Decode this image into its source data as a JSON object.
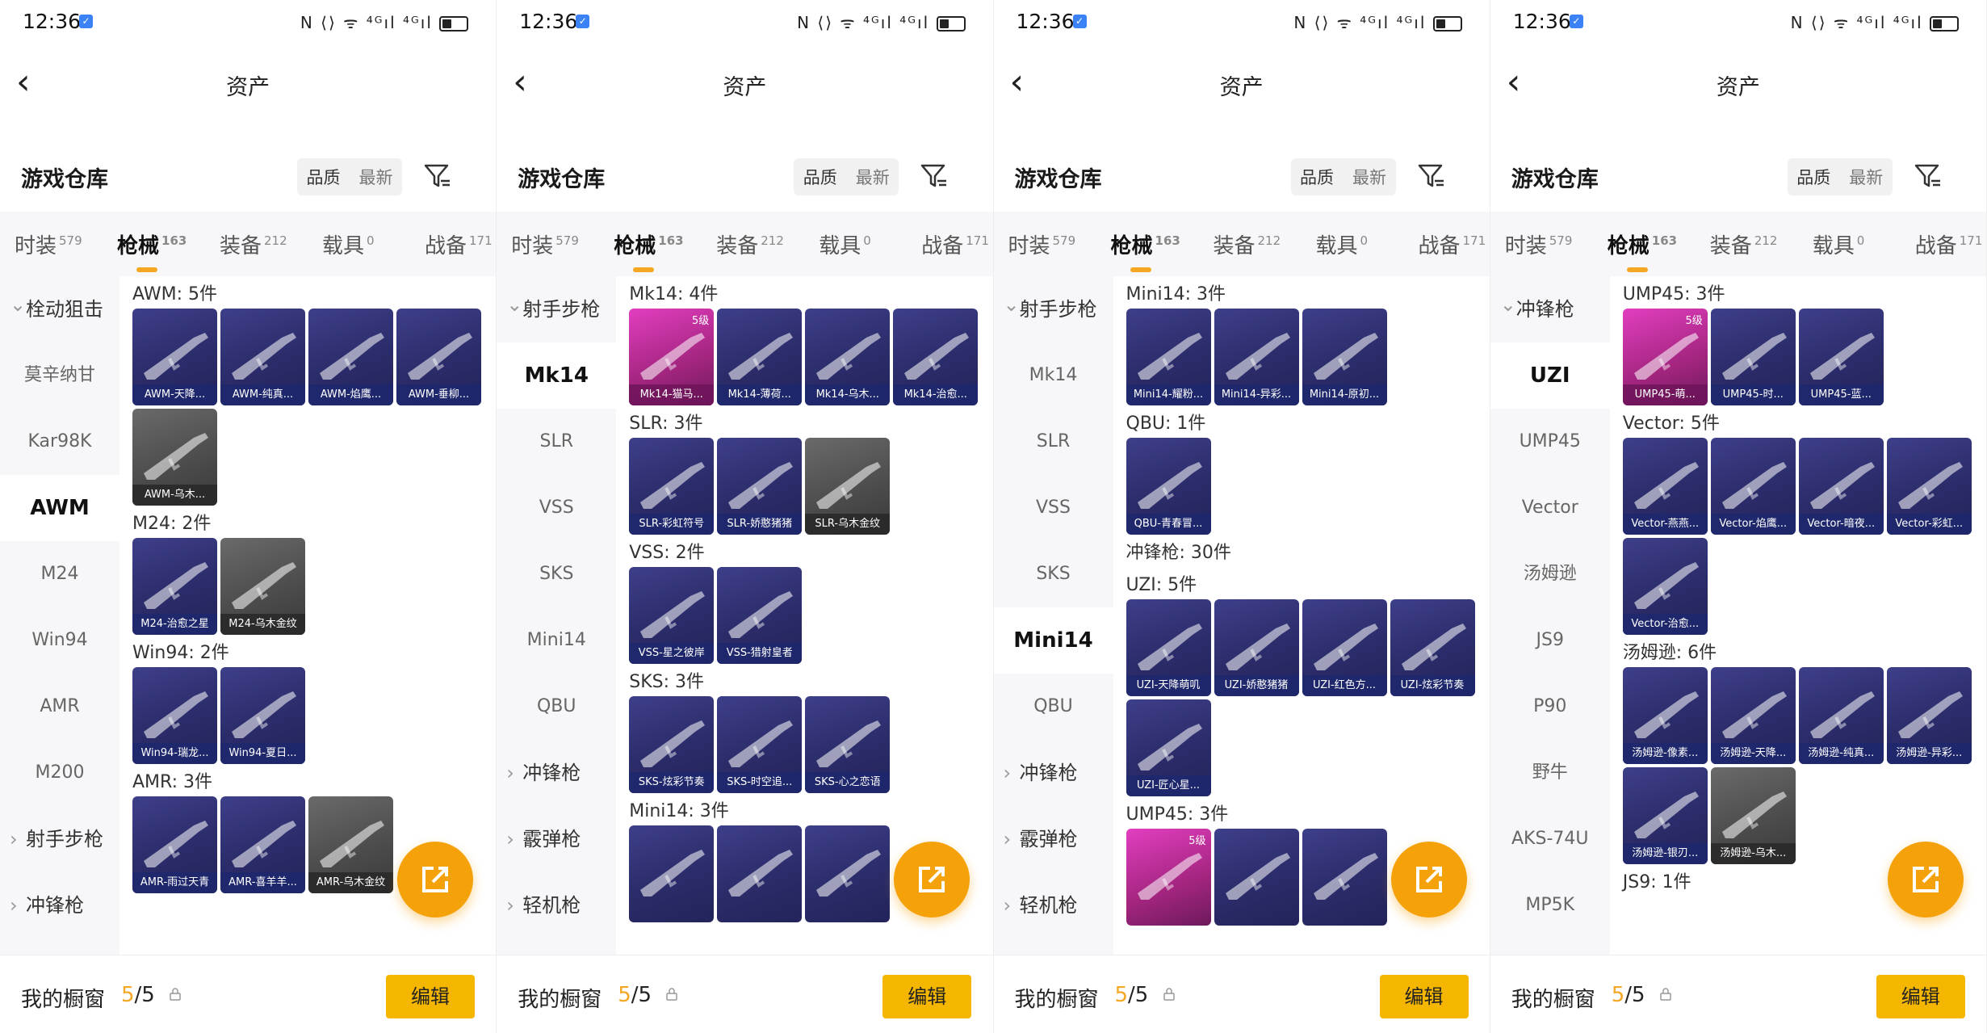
{
  "status": {
    "time": "12:36",
    "icons": "N ⟨⟩ ᯤ ⁴ᴳıl ⁴ᴳıl"
  },
  "header": {
    "back": "<",
    "title": "资产"
  },
  "warehouse": {
    "title": "游戏仓库",
    "sort_quality": "品质",
    "sort_latest": "最新"
  },
  "tabs": [
    {
      "label": "时装",
      "count": "579"
    },
    {
      "label": "枪械",
      "count": "163"
    },
    {
      "label": "装备",
      "count": "212"
    },
    {
      "label": "载具",
      "count": "0"
    },
    {
      "label": "战备",
      "count": "171"
    }
  ],
  "footer": {
    "label": "我的橱窗",
    "current": "5",
    "total": "/5",
    "edit": "编辑"
  },
  "colors": {
    "accent": "#f5a623",
    "fab": "#f5a10a",
    "edit_button": "#f5b600"
  },
  "panels": [
    {
      "sidebar": [
        {
          "label": "栓动狙击",
          "type": "cat",
          "open": true
        },
        {
          "label": "莫辛纳甘"
        },
        {
          "label": "Kar98K"
        },
        {
          "label": "AWM",
          "active": true
        },
        {
          "label": "M24"
        },
        {
          "label": "Win94"
        },
        {
          "label": "AMR"
        },
        {
          "label": "M200"
        },
        {
          "label": "射手步枪",
          "type": "cat"
        },
        {
          "label": "冲锋枪",
          "type": "cat"
        }
      ],
      "groups": [
        {
          "title": "AWM: 5件",
          "items": [
            {
              "name": "AWM-天降..."
            },
            {
              "name": "AWM-纯真..."
            },
            {
              "name": "AWM-焰鹰..."
            },
            {
              "name": "AWM-垂柳..."
            },
            {
              "name": "AWM-乌木...",
              "style": "gray"
            }
          ]
        },
        {
          "title": "M24: 2件",
          "items": [
            {
              "name": "M24-治愈之星"
            },
            {
              "name": "M24-乌木金纹",
              "style": "gray"
            }
          ]
        },
        {
          "title": "Win94: 2件",
          "items": [
            {
              "name": "Win94-瑞龙..."
            },
            {
              "name": "Win94-夏日..."
            }
          ]
        },
        {
          "title": "AMR: 3件",
          "items": [
            {
              "name": "AMR-雨过天青"
            },
            {
              "name": "AMR-喜羊羊..."
            },
            {
              "name": "AMR-乌木金纹",
              "style": "gray"
            }
          ]
        }
      ]
    },
    {
      "sidebar": [
        {
          "label": "射手步枪",
          "type": "cat",
          "open": true
        },
        {
          "label": "Mk14",
          "active": true
        },
        {
          "label": "SLR"
        },
        {
          "label": "VSS"
        },
        {
          "label": "SKS"
        },
        {
          "label": "Mini14"
        },
        {
          "label": "QBU"
        },
        {
          "label": "冲锋枪",
          "type": "cat"
        },
        {
          "label": "霰弹枪",
          "type": "cat"
        },
        {
          "label": "轻机枪",
          "type": "cat"
        }
      ],
      "groups": [
        {
          "title": "Mk14: 4件",
          "items": [
            {
              "name": "Mk14-猫马...",
              "style": "pink",
              "level": "5级"
            },
            {
              "name": "Mk14-薄荷..."
            },
            {
              "name": "Mk14-乌木..."
            },
            {
              "name": "Mk14-治愈..."
            }
          ]
        },
        {
          "title": "SLR: 3件",
          "items": [
            {
              "name": "SLR-彩虹符号"
            },
            {
              "name": "SLR-娇憨猪猪"
            },
            {
              "name": "SLR-乌木金纹",
              "style": "gray"
            }
          ]
        },
        {
          "title": "VSS: 2件",
          "items": [
            {
              "name": "VSS-星之彼岸"
            },
            {
              "name": "VSS-猎射皇者"
            }
          ]
        },
        {
          "title": "SKS: 3件",
          "items": [
            {
              "name": "SKS-炫彩节奏"
            },
            {
              "name": "SKS-时空追..."
            },
            {
              "name": "SKS-心之恋语"
            }
          ]
        },
        {
          "title": "Mini14: 3件",
          "items": [
            {
              "name": ""
            },
            {
              "name": ""
            },
            {
              "name": ""
            }
          ]
        }
      ]
    },
    {
      "sidebar": [
        {
          "label": "射手步枪",
          "type": "cat",
          "open": true
        },
        {
          "label": "Mk14"
        },
        {
          "label": "SLR"
        },
        {
          "label": "VSS"
        },
        {
          "label": "SKS"
        },
        {
          "label": "Mini14",
          "active": true
        },
        {
          "label": "QBU"
        },
        {
          "label": "冲锋枪",
          "type": "cat"
        },
        {
          "label": "霰弹枪",
          "type": "cat"
        },
        {
          "label": "轻机枪",
          "type": "cat"
        }
      ],
      "groups": [
        {
          "title": "Mini14: 3件",
          "items": [
            {
              "name": "Mini14-耀粉..."
            },
            {
              "name": "Mini14-异彩..."
            },
            {
              "name": "Mini14-原初..."
            }
          ]
        },
        {
          "title": "QBU: 1件",
          "items": [
            {
              "name": "QBU-青春冒..."
            }
          ]
        },
        {
          "title": "冲锋枪: 30件",
          "items": []
        },
        {
          "title": "UZI: 5件",
          "items": [
            {
              "name": "UZI-天降萌叽"
            },
            {
              "name": "UZI-娇憨猪猪"
            },
            {
              "name": "UZI-红色方..."
            },
            {
              "name": "UZI-炫彩节奏"
            },
            {
              "name": "UZI-匠心星..."
            }
          ]
        },
        {
          "title": "UMP45: 3件",
          "items": [
            {
              "name": "",
              "style": "pink",
              "level": "5级"
            },
            {
              "name": ""
            },
            {
              "name": ""
            }
          ]
        }
      ]
    },
    {
      "sidebar": [
        {
          "label": "冲锋枪",
          "type": "cat",
          "open": true
        },
        {
          "label": "UZI",
          "active": true
        },
        {
          "label": "UMP45"
        },
        {
          "label": "Vector"
        },
        {
          "label": "汤姆逊"
        },
        {
          "label": "JS9"
        },
        {
          "label": "P90"
        },
        {
          "label": "野牛"
        },
        {
          "label": "AKS-74U"
        },
        {
          "label": "MP5K"
        }
      ],
      "groups": [
        {
          "title": "UMP45: 3件",
          "items": [
            {
              "name": "UMP45-萌...",
              "style": "pink",
              "level": "5级"
            },
            {
              "name": "UMP45-时..."
            },
            {
              "name": "UMP45-蓝..."
            }
          ]
        },
        {
          "title": "Vector: 5件",
          "items": [
            {
              "name": "Vector-燕燕..."
            },
            {
              "name": "Vector-焰鹰..."
            },
            {
              "name": "Vector-暗夜..."
            },
            {
              "name": "Vector-彩虹..."
            },
            {
              "name": "Vector-治愈..."
            }
          ]
        },
        {
          "title": "汤姆逊: 6件",
          "items": [
            {
              "name": "汤姆逊-像素..."
            },
            {
              "name": "汤姆逊-天降..."
            },
            {
              "name": "汤姆逊-纯真..."
            },
            {
              "name": "汤姆逊-异彩..."
            },
            {
              "name": "汤姆逊-银刃..."
            },
            {
              "name": "汤姆逊-乌木...",
              "style": "gray"
            }
          ]
        },
        {
          "title": "JS9: 1件",
          "items": []
        }
      ]
    }
  ]
}
